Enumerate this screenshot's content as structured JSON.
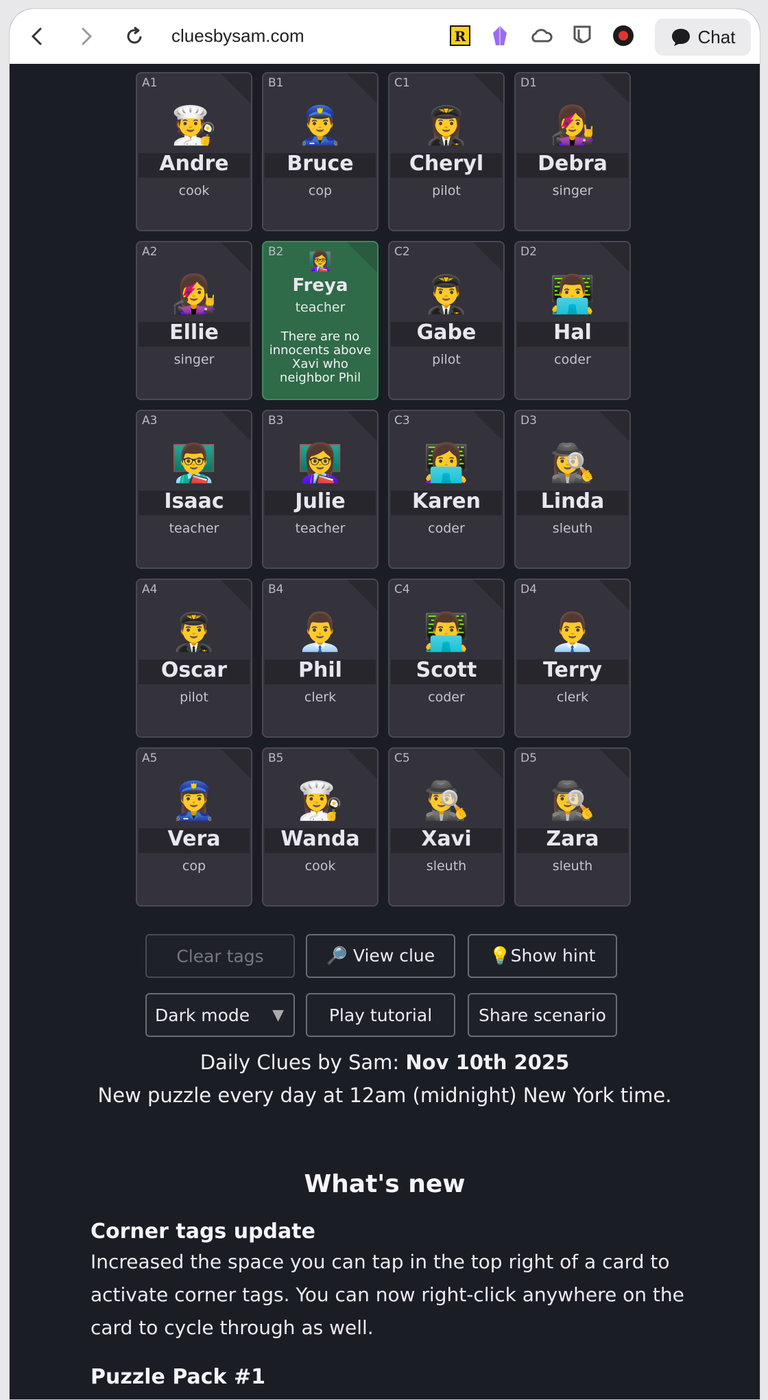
{
  "browser": {
    "url": "cluesbysam.com",
    "chat_label": "Chat",
    "extensions": [
      "r-badge-icon",
      "crystal-icon",
      "cloud-icon",
      "shield-icon",
      "record-icon"
    ]
  },
  "cards": [
    {
      "coord": "A1",
      "name": "Andre",
      "profession": "cook",
      "emoji": "🧑‍🍳"
    },
    {
      "coord": "B1",
      "name": "Bruce",
      "profession": "cop",
      "emoji": "👮‍♂️"
    },
    {
      "coord": "C1",
      "name": "Cheryl",
      "profession": "pilot",
      "emoji": "👩‍✈️"
    },
    {
      "coord": "D1",
      "name": "Debra",
      "profession": "singer",
      "emoji": "👩‍🎤"
    },
    {
      "coord": "A2",
      "name": "Ellie",
      "profession": "singer",
      "emoji": "👩‍🎤"
    },
    {
      "coord": "B2",
      "name": "Freya",
      "profession": "teacher",
      "emoji": "👩‍🏫",
      "revealed": true,
      "clue": "There are no innocents above Xavi who neighbor Phil"
    },
    {
      "coord": "C2",
      "name": "Gabe",
      "profession": "pilot",
      "emoji": "👨‍✈️"
    },
    {
      "coord": "D2",
      "name": "Hal",
      "profession": "coder",
      "emoji": "👨‍💻"
    },
    {
      "coord": "A3",
      "name": "Isaac",
      "profession": "teacher",
      "emoji": "👨‍🏫"
    },
    {
      "coord": "B3",
      "name": "Julie",
      "profession": "teacher",
      "emoji": "👩‍🏫"
    },
    {
      "coord": "C3",
      "name": "Karen",
      "profession": "coder",
      "emoji": "👩‍💻"
    },
    {
      "coord": "D3",
      "name": "Linda",
      "profession": "sleuth",
      "emoji": "🕵️‍♀️"
    },
    {
      "coord": "A4",
      "name": "Oscar",
      "profession": "pilot",
      "emoji": "👨‍✈️"
    },
    {
      "coord": "B4",
      "name": "Phil",
      "profession": "clerk",
      "emoji": "👨‍💼"
    },
    {
      "coord": "C4",
      "name": "Scott",
      "profession": "coder",
      "emoji": "👨‍💻"
    },
    {
      "coord": "D4",
      "name": "Terry",
      "profession": "clerk",
      "emoji": "👨‍💼"
    },
    {
      "coord": "A5",
      "name": "Vera",
      "profession": "cop",
      "emoji": "👮‍♀️"
    },
    {
      "coord": "B5",
      "name": "Wanda",
      "profession": "cook",
      "emoji": "👩‍🍳"
    },
    {
      "coord": "C5",
      "name": "Xavi",
      "profession": "sleuth",
      "emoji": "🕵️‍♂️"
    },
    {
      "coord": "D5",
      "name": "Zara",
      "profession": "sleuth",
      "emoji": "🕵️‍♀️"
    }
  ],
  "buttons": {
    "clear_tags": "Clear tags",
    "view_clue": "🔎 View clue",
    "show_hint": "💡Show hint",
    "dark_mode": "Dark mode",
    "play_tutorial": "Play tutorial",
    "share_scenario": "Share scenario"
  },
  "daily": {
    "prefix": "Daily Clues by Sam: ",
    "date": "Nov 10th 2025",
    "schedule": "New puzzle every day at 12am (midnight) New York time."
  },
  "whats_new": {
    "heading": "What's new",
    "items": [
      {
        "title": "Corner tags update",
        "body": "Increased the space you can tap in the top right of a card to activate corner tags. You can now right-click anywhere on the card to cycle through as well."
      },
      {
        "title": "Puzzle Pack #1",
        "body": ""
      }
    ]
  }
}
